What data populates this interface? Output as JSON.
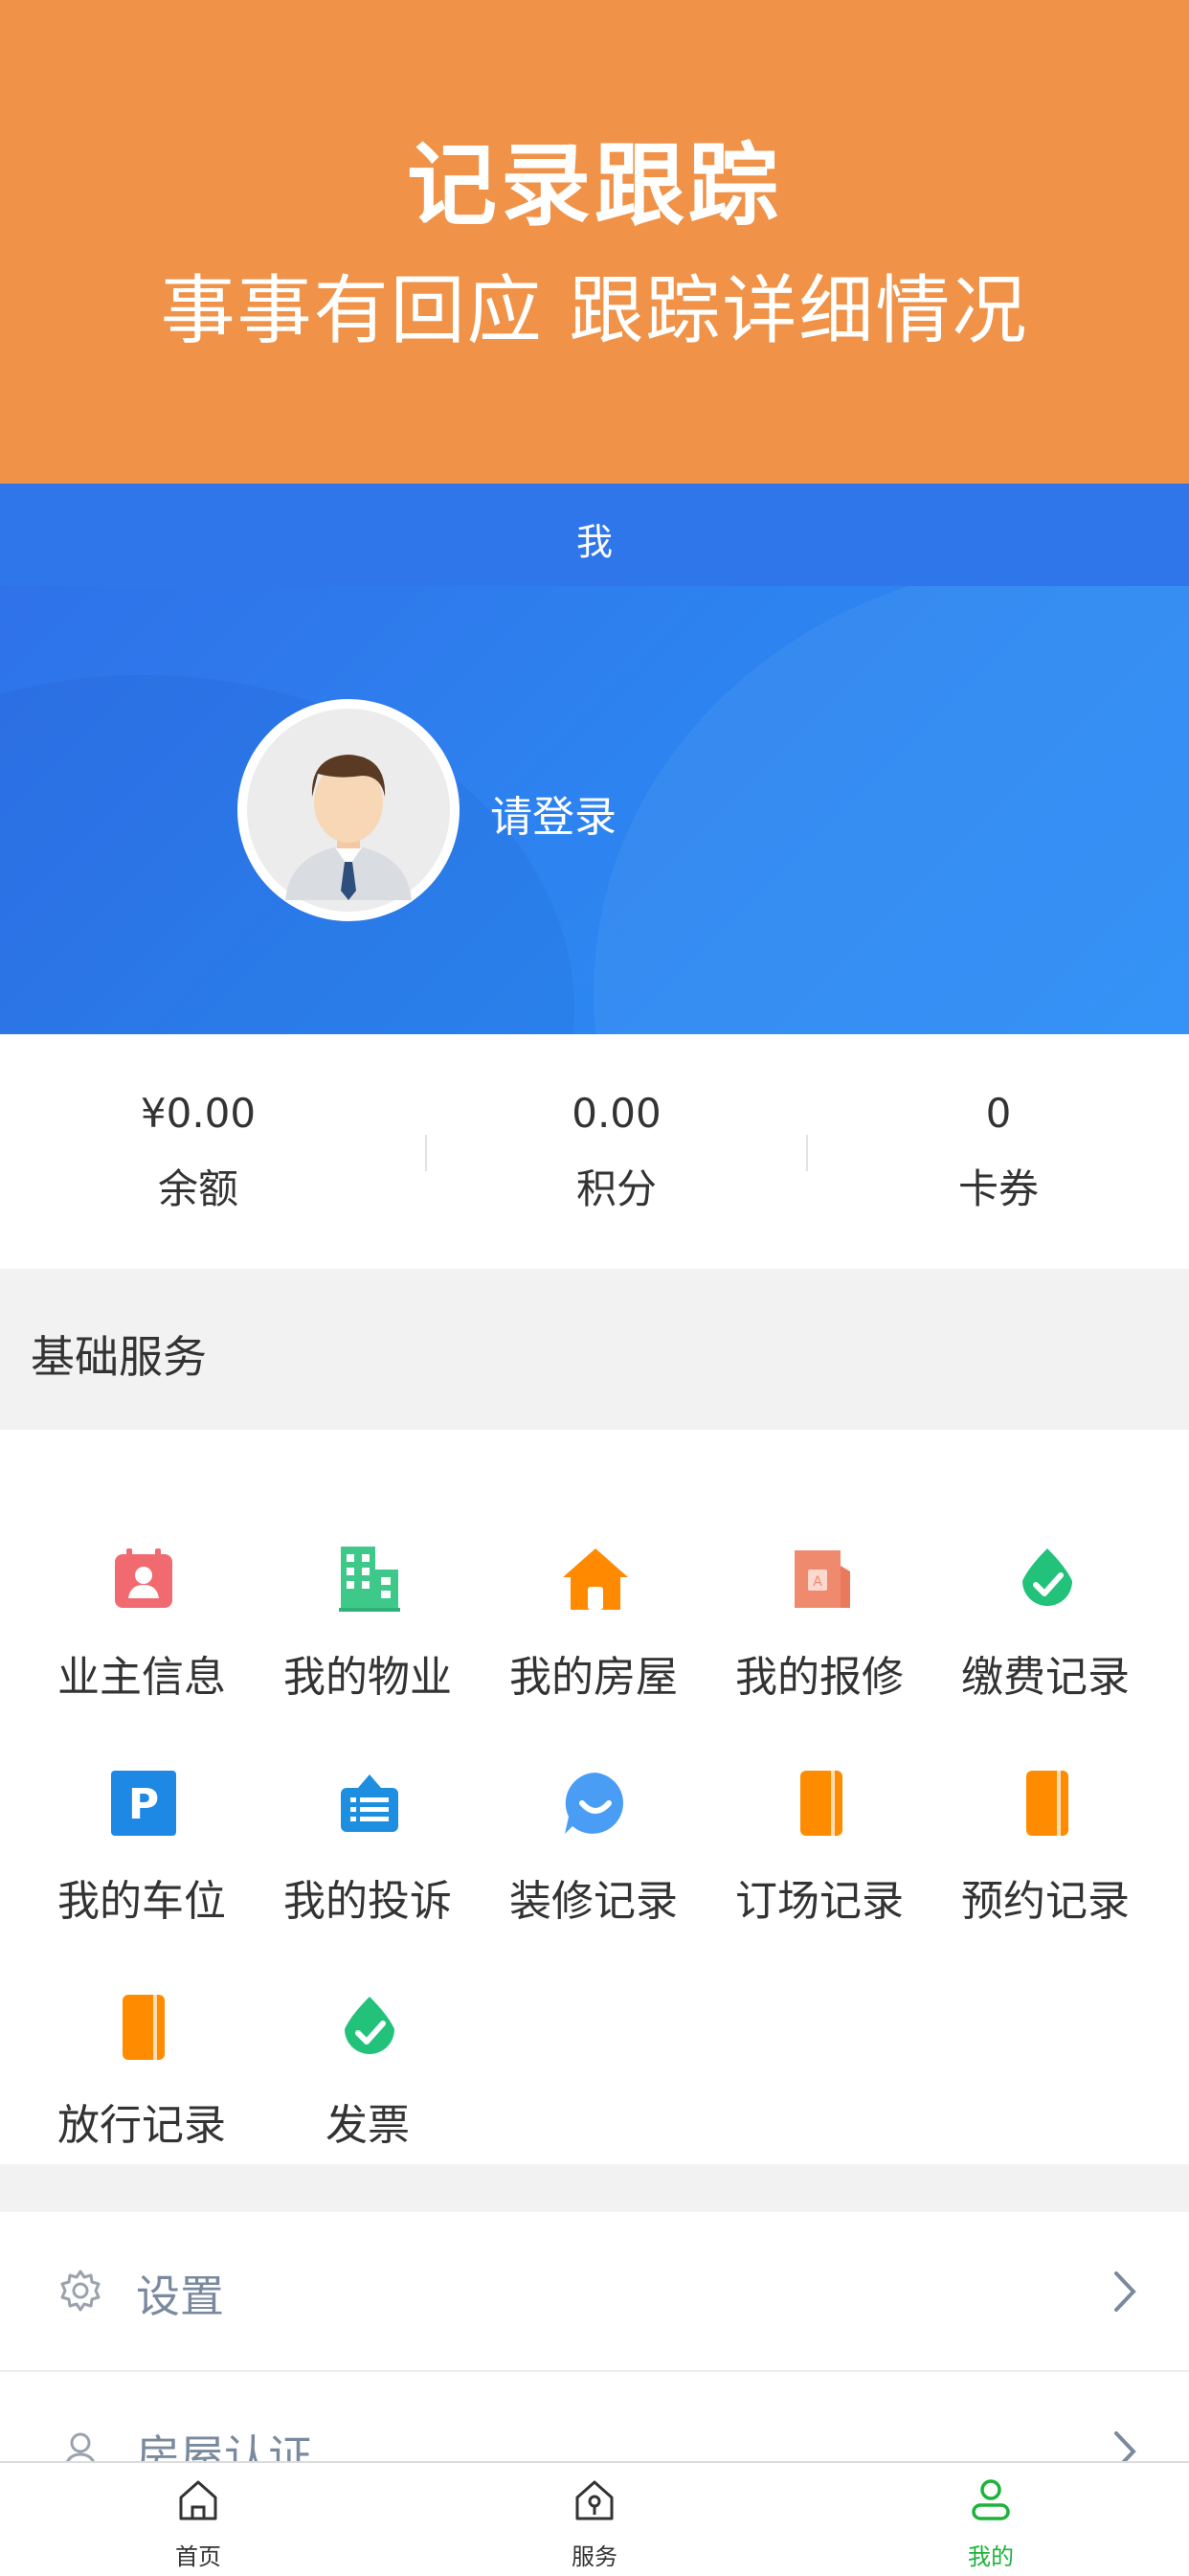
{
  "banner": {
    "title": "记录跟踪",
    "subtitle": "事事有回应 跟踪详细情况"
  },
  "header": {
    "title": "我",
    "login_text": "请登录"
  },
  "stats": [
    {
      "value": "¥0.00",
      "label": "余额"
    },
    {
      "value": "0.00",
      "label": "积分"
    },
    {
      "value": "0",
      "label": "卡券"
    }
  ],
  "services": {
    "title": "基础服务",
    "items": [
      {
        "label": "业主信息",
        "icon": "owner-info-icon",
        "color": "#f06a70"
      },
      {
        "label": "我的物业",
        "icon": "building-icon",
        "color": "#3ec98a"
      },
      {
        "label": "我的房屋",
        "icon": "house-icon",
        "color": "#ff8a00"
      },
      {
        "label": "我的报修",
        "icon": "repair-icon",
        "color": "#f08a6e"
      },
      {
        "label": "缴费记录",
        "icon": "payment-check-icon",
        "color": "#22c27a"
      },
      {
        "label": "我的车位",
        "icon": "parking-icon",
        "color": "#1e88e5"
      },
      {
        "label": "我的投诉",
        "icon": "complaint-icon",
        "color": "#1e8fe0"
      },
      {
        "label": "装修记录",
        "icon": "chat-smile-icon",
        "color": "#4a9df5"
      },
      {
        "label": "订场记录",
        "icon": "notebook-icon",
        "color": "#ff8c00"
      },
      {
        "label": "预约记录",
        "icon": "notebook-icon",
        "color": "#ff8c00"
      },
      {
        "label": "放行记录",
        "icon": "notebook-icon",
        "color": "#ff8c00"
      },
      {
        "label": "发票",
        "icon": "payment-check-icon",
        "color": "#22c27a"
      }
    ]
  },
  "list": [
    {
      "label": "设置",
      "icon": "gear-icon"
    },
    {
      "label": "房屋认证",
      "icon": "user-icon"
    }
  ],
  "tabbar": [
    {
      "label": "首页",
      "icon": "home-icon",
      "active": false
    },
    {
      "label": "服务",
      "icon": "service-house-icon",
      "active": false
    },
    {
      "label": "我的",
      "icon": "profile-icon",
      "active": true
    }
  ],
  "colors": {
    "banner": "#f09248",
    "header": "#2e7cf0",
    "active_tab": "#1db33a"
  }
}
